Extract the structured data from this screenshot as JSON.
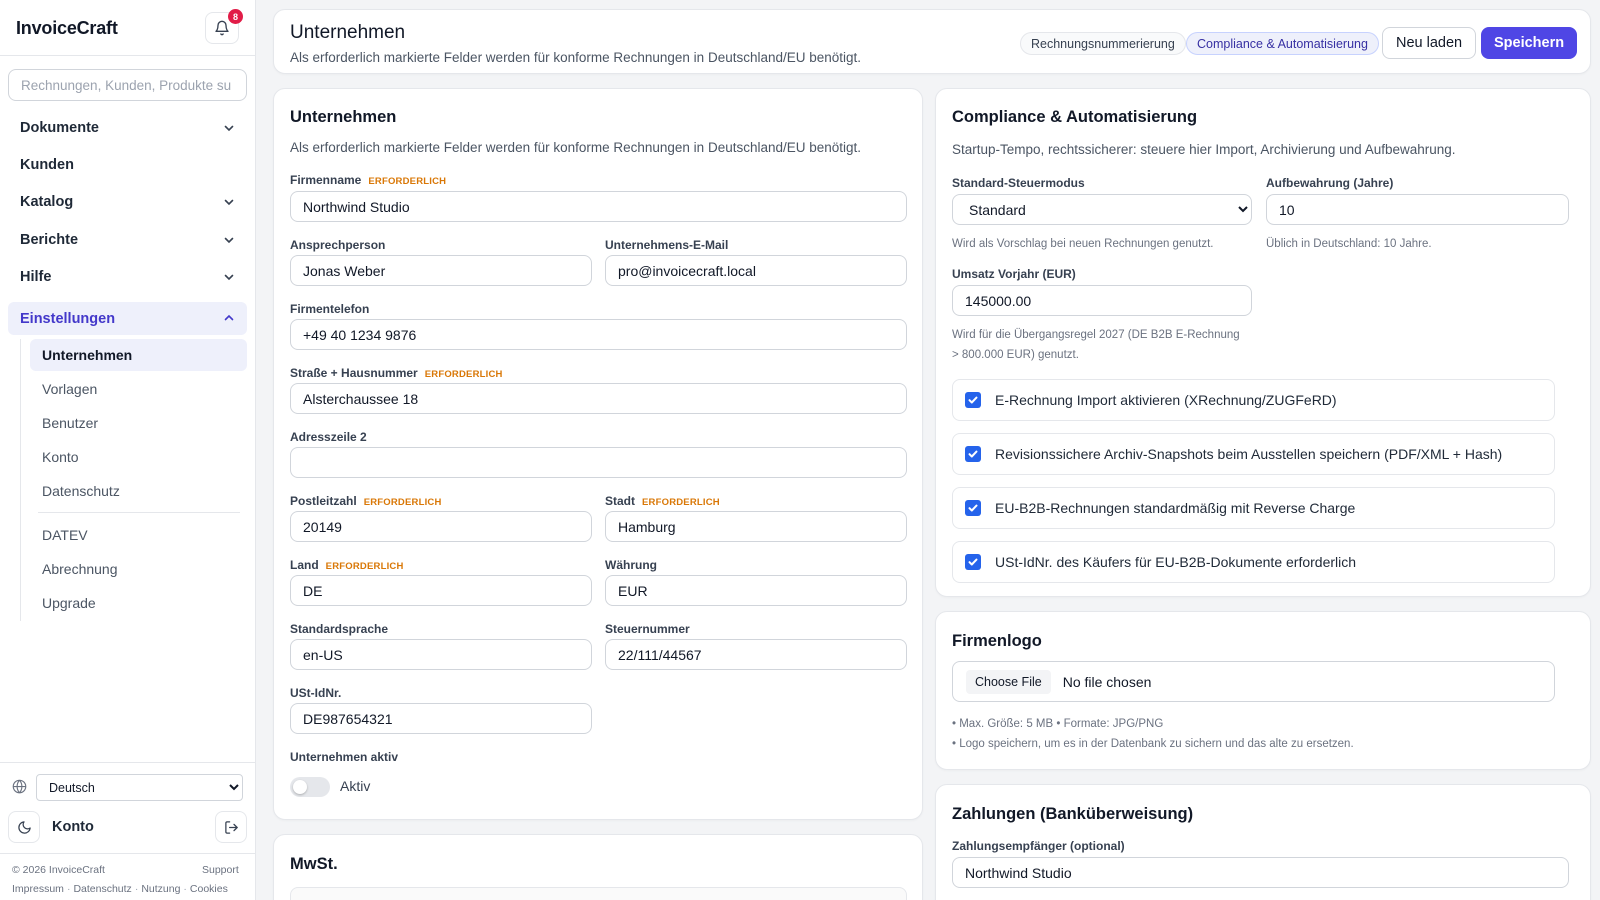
{
  "app": {
    "name": "InvoiceCraft",
    "notifications": "8"
  },
  "search": {
    "placeholder": "Rechnungen, Kunden, Produkte su"
  },
  "nav": {
    "dokumente": "Dokumente",
    "kunden": "Kunden",
    "katalog": "Katalog",
    "berichte": "Berichte",
    "hilfe": "Hilfe",
    "einstellungen": "Einstellungen",
    "sub": {
      "unternehmen": "Unternehmen",
      "vorlagen": "Vorlagen",
      "benutzer": "Benutzer",
      "konto": "Konto",
      "datenschutz": "Datenschutz",
      "datev": "DATEV",
      "abrechnung": "Abrechnung",
      "upgrade": "Upgrade"
    }
  },
  "sidebar_footer": {
    "language": "Deutsch",
    "account": "Konto",
    "copyright": "© 2026 InvoiceCraft",
    "support": "Support",
    "links": [
      "Impressum",
      "Datenschutz",
      "Nutzung",
      "Cookies"
    ]
  },
  "header": {
    "title": "Unternehmen",
    "subtitle": "Als erforderlich markierte Felder werden für konforme Rechnungen in Deutschland/EU benötigt.",
    "pill_numbering": "Rechnungsnummerierung",
    "pill_compliance": "Compliance & Automatisierung",
    "reload": "Neu laden",
    "save": "Speichern"
  },
  "company": {
    "title": "Unternehmen",
    "desc": "Als erforderlich markierte Felder werden für konforme Rechnungen in Deutschland/EU benötigt.",
    "required_tag": "ERFORDERLICH",
    "labels": {
      "firm_name": "Firmenname",
      "contact": "Ansprechperson",
      "email": "Unternehmens-E-Mail",
      "phone": "Firmentelefon",
      "street": "Straße + Hausnummer",
      "address2": "Adresszeile 2",
      "zip": "Postleitzahl",
      "city": "Stadt",
      "country": "Land",
      "currency": "Währung",
      "language": "Standardsprache",
      "tax_number": "Steuernummer",
      "vat_id": "USt-IdNr.",
      "active": "Unternehmen aktiv"
    },
    "values": {
      "firm_name": "Northwind Studio",
      "contact": "Jonas Weber",
      "email": "pro@invoicecraft.local",
      "phone": "+49 40 1234 9876",
      "street": "Alsterchaussee 18",
      "address2": "",
      "zip": "20149",
      "city": "Hamburg",
      "country": "DE",
      "currency": "EUR",
      "language": "en-US",
      "tax_number": "22/111/44567",
      "vat_id": "DE987654321"
    },
    "active_toggle": false,
    "active_label": "Aktiv"
  },
  "mwst": {
    "title": "MwSt."
  },
  "compliance": {
    "title": "Compliance & Automatisierung",
    "desc": "Startup-Tempo, rechtssicherer: steuere hier Import, Archivierung und Aufbewahrung.",
    "tax_mode_label": "Standard-Steuermodus",
    "tax_mode_value": "Standard",
    "tax_mode_hint": "Wird als Vorschlag bei neuen Rechnungen genutzt.",
    "retention_label": "Aufbewahrung (Jahre)",
    "retention_value": "10",
    "retention_hint": "Üblich in Deutschland: 10 Jahre.",
    "revenue_label": "Umsatz Vorjahr (EUR)",
    "revenue_value": "145000.00",
    "revenue_hint_1": "Wird für die Übergangsregel 2027 (DE B2B E-Rechnung",
    "revenue_hint_2": "> 800.000 EUR) genutzt.",
    "checks": [
      {
        "label": "E-Rechnung Import aktivieren (XRechnung/ZUGFeRD)",
        "checked": true
      },
      {
        "label": "Revisionssichere Archiv-Snapshots beim Ausstellen speichern (PDF/XML + Hash)",
        "checked": true
      },
      {
        "label": "EU-B2B-Rechnungen standardmäßig mit Reverse Charge",
        "checked": true
      },
      {
        "label": "USt-IdNr. des Käufers für EU-B2B-Dokumente erforderlich",
        "checked": true
      }
    ]
  },
  "logo": {
    "title": "Firmenlogo",
    "choose": "Choose File",
    "none": "No file chosen",
    "hint_1": "• Max. Größe: 5 MB • Formate: JPG/PNG",
    "hint_2": "• Logo speichern, um es in der Datenbank zu sichern und das alte zu ersetzen."
  },
  "payments": {
    "title": "Zahlungen (Banküberweisung)",
    "payee_label": "Zahlungsempfänger (optional)",
    "payee_value": "Northwind Studio"
  },
  "colors": {
    "accent": "#4f46e5",
    "required": "#d97706",
    "badge": "#e11d48",
    "checkbox": "#2563eb"
  }
}
